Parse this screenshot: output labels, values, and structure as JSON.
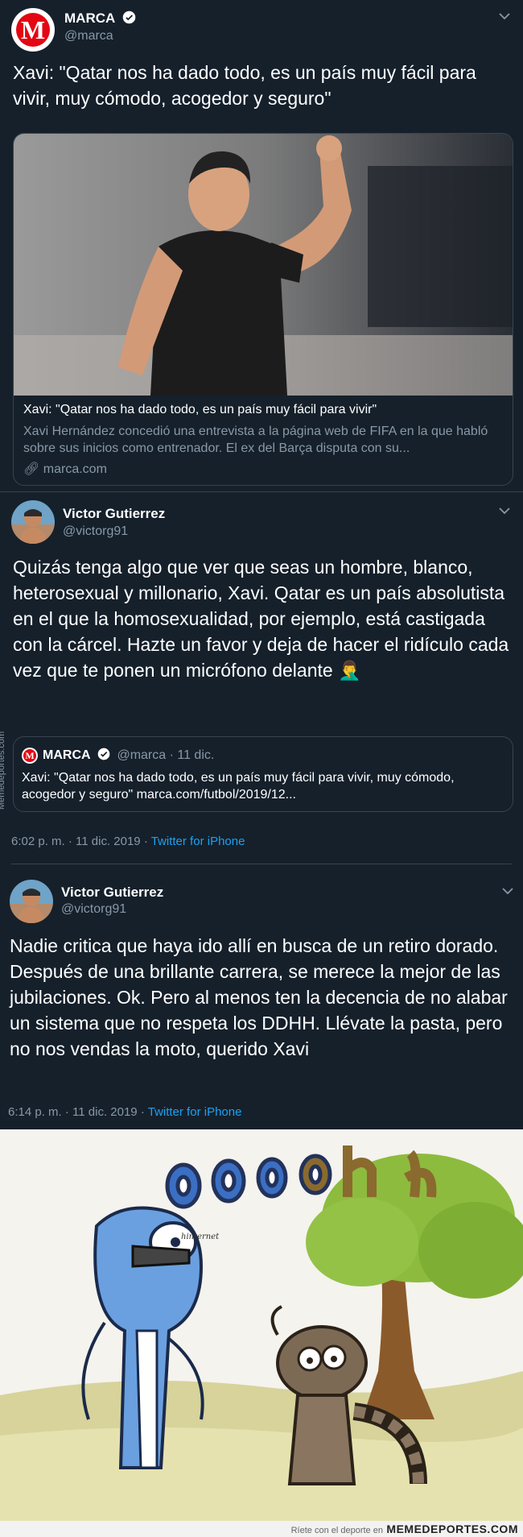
{
  "tweet1": {
    "name": "MARCA",
    "handle": "@marca",
    "logo_letter": "M",
    "text": "Xavi: \"Qatar nos ha dado todo, es un país muy fácil para vivir, muy cómodo, acogedor y seguro\"",
    "card": {
      "title": "Xavi: \"Qatar nos ha dado todo, es un país muy fácil para vivir\"",
      "description": "Xavi Hernández concedió una entrevista a la página web de FIFA en la que habló sobre sus inicios como entrenador. El ex del Barça disputa con su...",
      "domain": "marca.com"
    }
  },
  "tweet2": {
    "name": "Victor Gutierrez",
    "handle": "@victorg91",
    "text": "Quizás tenga algo que ver que seas un hombre, blanco, heterosexual y millonario, Xavi. Qatar es un país absolutista en el que la homosexualidad, por ejemplo, está castigada con la cárcel. Hazte un favor y deja de hacer el ridículo cada vez que te ponen un micrófono delante 🤦‍♂️",
    "quote": {
      "name": "MARCA",
      "handle": "@marca · 11 dic.",
      "logo_letter": "M",
      "text": "Xavi: \"Qatar nos ha dado todo, es un país muy fácil para vivir, muy cómodo, acogedor y seguro\" marca.com/futbol/2019/12..."
    },
    "timestamp": "6:02 p. m. · 11 dic. 2019 · ",
    "source": "Twitter for iPhone"
  },
  "tweet3": {
    "name": "Victor Gutierrez",
    "handle": "@victorg91",
    "text": "Nadie critica que haya ido allí en busca de un retiro dorado. Después de una brillante carrera, se merece la mejor de las jubilaciones. Ok. Pero al menos ten la decencia de no alabar un sistema que no respeta los DDHH. Llévate la pasta, pero no nos vendas la moto, querido Xavi",
    "timestamp": "6:14 p. m. · 11 dic. 2019 · ",
    "source": "Twitter for iPhone"
  },
  "meme": {
    "letters": "oooohh",
    "caption": "Ríete con el deporte en",
    "brand": "MEMEDEPORTES.COM",
    "side_watermark": "Memedeportes.com",
    "signature": "hinternet"
  }
}
